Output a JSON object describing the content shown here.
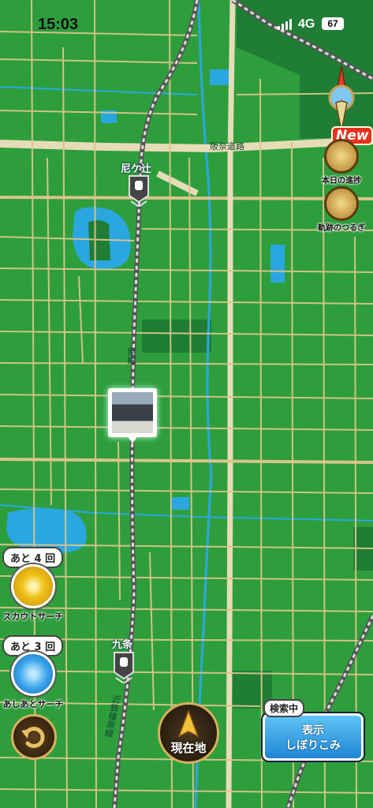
{
  "status_bar": {
    "time": "15:03",
    "network": "4G",
    "battery": "67"
  },
  "map": {
    "labels": {
      "station_north": "尼ケ辻",
      "station_south": "九条",
      "road_hanna": "阪奈道路",
      "line_upper": "原線",
      "line_lower": "近鉄橿原線"
    },
    "colors": {
      "land": "#2e9e3c",
      "road": "#d8c58a",
      "water": "#2aa7e0",
      "forest": "#1f7d35"
    }
  },
  "buttons": {
    "progress": {
      "label": "本日の進捗",
      "badge": "New"
    },
    "tracks": {
      "label": "軌跡のつるぎ"
    },
    "scout": {
      "remaining": "あと 4 回",
      "label": "スカウトサーチ"
    },
    "footprint": {
      "remaining": "あと 3 回",
      "label": "あしあとサーチ"
    },
    "current_location": {
      "label": "現在地"
    },
    "filter": {
      "line1": "表示",
      "line2": "しぼりこみ",
      "status": "検索中"
    }
  },
  "icons": [
    "compass-icon",
    "back-arrow-icon",
    "current-location-arrow-icon",
    "train-station-icon",
    "footprint-icon",
    "scout-target-icon",
    "sword-icon",
    "progress-book-icon"
  ]
}
